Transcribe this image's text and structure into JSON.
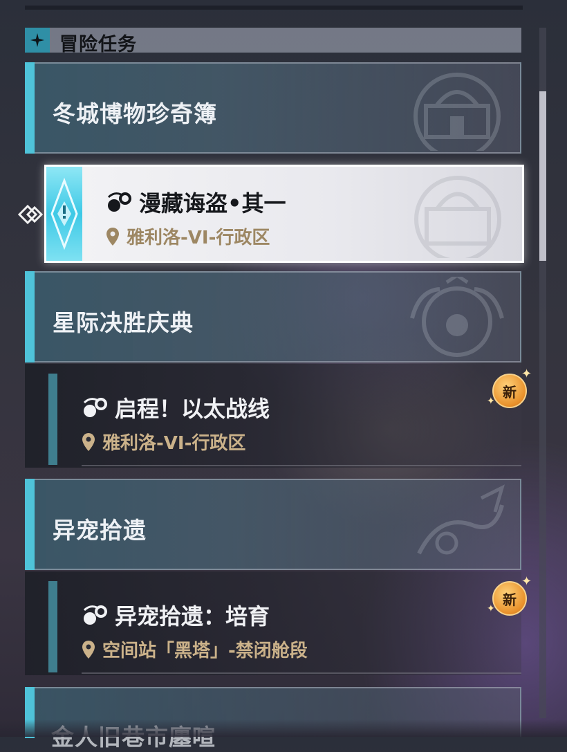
{
  "header": {
    "title": "冒险任务",
    "icon": "sparkle-diamond-icon"
  },
  "categories": [
    {
      "label": "冬城博物珍奇簿"
    },
    {
      "label": "星际决胜庆典"
    },
    {
      "label": "异宠拾遗"
    },
    {
      "label": "金人旧巷市廛喧"
    }
  ],
  "quests": [
    {
      "title": "漫藏诲盗•其一",
      "location": "雅利洛-VI-行政区",
      "selected": true
    },
    {
      "title": "启程！以太战线",
      "location": "雅利洛-VI-行政区",
      "badge": "新"
    },
    {
      "title": "异宠拾遗：培育",
      "location": "空间站「黑塔」-禁闭舱段",
      "badge": "新"
    }
  ],
  "colors": {
    "accent": "#4fc3d9",
    "location_text": "#cbb28a",
    "badge": "#e8902a"
  }
}
